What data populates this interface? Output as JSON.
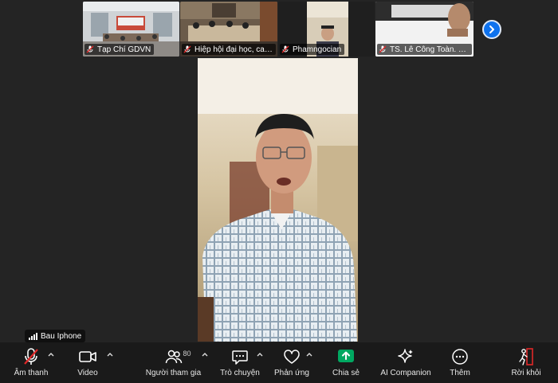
{
  "thumbnails": [
    {
      "name": "Tạp Chí GDVN",
      "muted": true
    },
    {
      "name": "Hiệp hội đại học, cao ...",
      "muted": true
    },
    {
      "name": "Phamngocian",
      "muted": true
    },
    {
      "name": "TS. Lê Công Toàn. Trườ...",
      "muted": true
    }
  ],
  "active_speaker": {
    "name": "Bau Iphone"
  },
  "toolbar": {
    "audio": "Âm thanh",
    "video": "Video",
    "participants": "Người tham gia",
    "participants_count": "80",
    "chat": "Trò chuyện",
    "reactions": "Phản ứng",
    "share": "Chia sẻ",
    "ai": "AI Companion",
    "more": "Thêm",
    "leave": "Rời khỏi"
  },
  "colors": {
    "accent": "#0e72ed",
    "share": "#00a861",
    "danger": "#e02828",
    "toolbar_bg": "#1a1a1a"
  }
}
